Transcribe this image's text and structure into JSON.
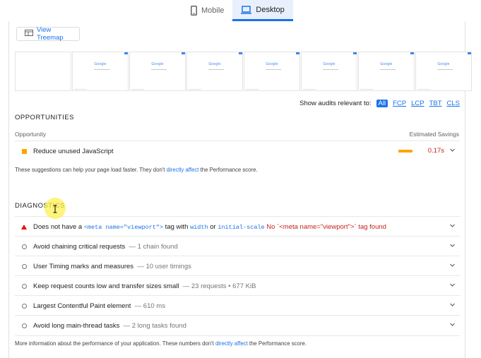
{
  "tabs": [
    {
      "label": "Mobile",
      "icon": "phone-icon"
    },
    {
      "label": "Desktop",
      "icon": "laptop-icon",
      "active": true
    }
  ],
  "treemap_button": {
    "label": "View Treemap",
    "icon": "treemap-icon"
  },
  "filmstrip": {
    "frame_logo_text": "Google",
    "frame_count": 8
  },
  "filter": {
    "label": "Show audits relevant to:",
    "chips": [
      "All",
      "FCP",
      "LCP",
      "TBT",
      "CLS"
    ],
    "active": "All"
  },
  "opportunities": {
    "title": "OPPORTUNITIES",
    "col_left": "Opportunity",
    "col_right": "Estimated Savings",
    "items": [
      {
        "label": "Reduce unused JavaScript",
        "savings": "0.17s"
      }
    ],
    "note_before": "These suggestions can help your page load faster. They don't ",
    "note_link": "directly affect",
    "note_after": " the Performance score."
  },
  "diagnostics": {
    "title": "DIAGNOSTICS",
    "viewport_item": {
      "p1": "Does not have a ",
      "code1": "<meta name=\"viewport\">",
      "p2": " tag with ",
      "code2": "width",
      "p3": " or ",
      "code3": "initial-scale",
      "p4": " No `<meta name=\"viewport\">` tag found"
    },
    "items": [
      {
        "label": "Avoid chaining critical requests",
        "detail": "— 1 chain found"
      },
      {
        "label": "User Timing marks and measures",
        "detail": "— 10 user timings"
      },
      {
        "label": "Keep request counts low and transfer sizes small",
        "detail": "— 23 requests • 677 KiB"
      },
      {
        "label": "Largest Contentful Paint element",
        "detail": "— 610 ms"
      },
      {
        "label": "Avoid long main-thread tasks",
        "detail": "— 2 long tasks found"
      }
    ],
    "note_before": "More information about the performance of your application. These numbers don't ",
    "note_link": "directly affect",
    "note_after": " the Performance score."
  },
  "colors": {
    "accent": "#1a73e8",
    "average": "#ffa400",
    "fail": "#eb0f00",
    "savings_text": "#c5221f"
  }
}
